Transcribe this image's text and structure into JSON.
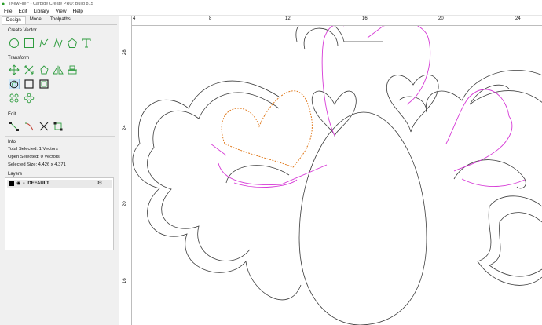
{
  "window": {
    "title": "[NewFile]* - Carbide Create PRO: Build 815"
  },
  "menu": [
    "File",
    "Edit",
    "Library",
    "View",
    "Help"
  ],
  "tabs": [
    {
      "label": "Design",
      "active": true
    },
    {
      "label": "Model",
      "active": false
    },
    {
      "label": "Toolpaths",
      "active": false
    }
  ],
  "sections": {
    "create_vector": "Create Vector",
    "transform": "Transform",
    "edit": "Edit",
    "info": "Info",
    "layers": "Layers"
  },
  "info": {
    "total_selected": "Total Selected:  1 Vectors",
    "open_selected": "Open Selected:  0 Vectors",
    "selected_size": "Selected Size:   4.426 x 4.371"
  },
  "layers": [
    {
      "name": "DEFAULT",
      "color": "#000000"
    }
  ],
  "rulers": {
    "horizontal": [
      "4",
      "8",
      "12",
      "16",
      "20",
      "24"
    ],
    "vertical": [
      "28",
      "24",
      "20",
      "16"
    ]
  },
  "colors": {
    "tool_icon": "#2e9c3e",
    "vector": "#3c3c3c",
    "selected_vector": "#e07a1e",
    "toolpath_vector": "#d63ad6",
    "ruler_marker": "#d62020"
  }
}
